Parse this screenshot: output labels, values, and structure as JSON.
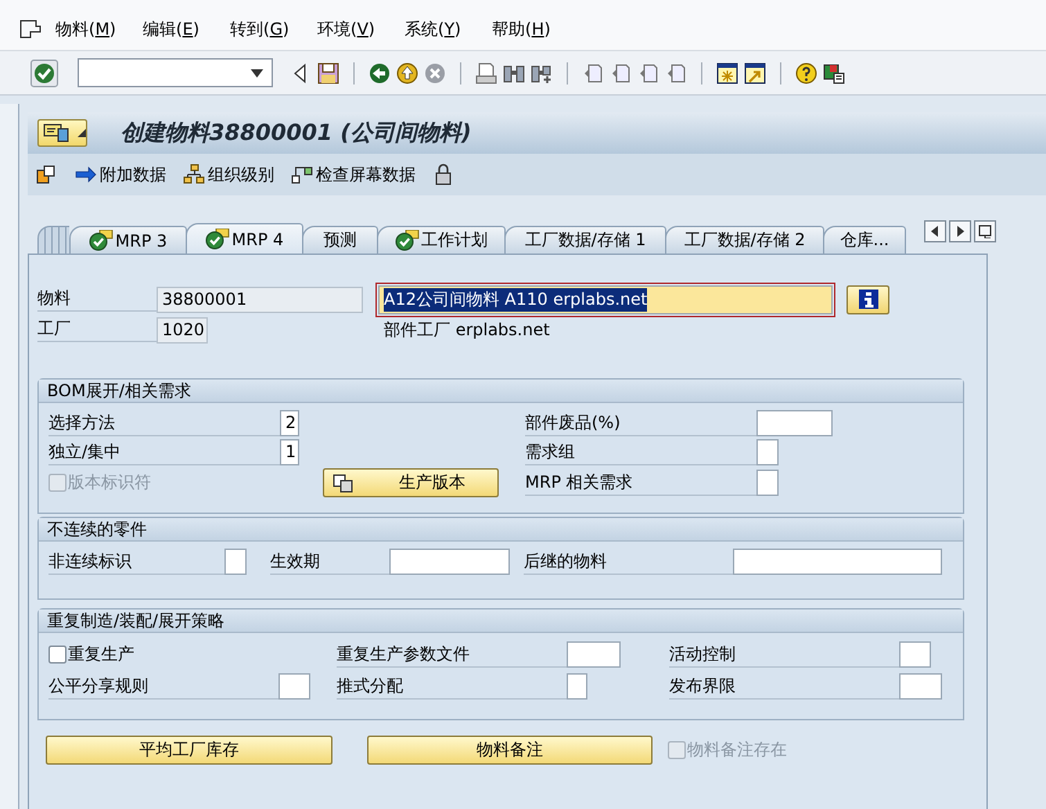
{
  "menu": [
    {
      "label": "物料(M)"
    },
    {
      "label": "编辑(E)"
    },
    {
      "label": "转到(G)"
    },
    {
      "label": "环境(V)"
    },
    {
      "label": "系统(Y)"
    },
    {
      "label": "帮助(H)"
    }
  ],
  "title": "创建物料38800001 (公司间物料)",
  "app_toolbar": [
    {
      "label": "附加数据"
    },
    {
      "label": "组织级别"
    },
    {
      "label": "检查屏幕数据"
    }
  ],
  "tabs": [
    {
      "label": "MRP 3",
      "selected": false,
      "checked": true
    },
    {
      "label": "MRP 4",
      "selected": true,
      "checked": true
    },
    {
      "label": "预测",
      "selected": false,
      "checked": false
    },
    {
      "label": "工作计划",
      "selected": false,
      "checked": true
    },
    {
      "label": "工厂数据/存储 1",
      "selected": false,
      "checked": false
    },
    {
      "label": "工厂数据/存储 2",
      "selected": false,
      "checked": false
    },
    {
      "label": "仓库...",
      "selected": false,
      "checked": false
    }
  ],
  "header": {
    "material_label": "物料",
    "material": "38800001",
    "description": "A12公司间物料 A110 erplabs.net",
    "description_selected": true,
    "plant_label": "工厂",
    "plant": "1020",
    "plant_description": "部件工厂 erplabs.net"
  },
  "bom": {
    "title": "BOM展开/相关需求",
    "selection_method": {
      "label": "选择方法",
      "value": "2"
    },
    "individual_collective": {
      "label": "独立/集中",
      "value": "1"
    },
    "version_indicator": {
      "label": "版本标识符",
      "checked": false,
      "disabled": true
    },
    "production_versions_button": "生产版本",
    "component_scrap": {
      "label": "部件废品(%)"
    },
    "requirements_group": {
      "label": "需求组"
    },
    "mrp_dependent": {
      "label": "MRP 相关需求"
    }
  },
  "discontinued": {
    "title": "不连续的零件",
    "indicator": {
      "label": "非连续标识"
    },
    "effective_out": {
      "label": "生效期"
    },
    "follow_up": {
      "label": "后继的物料"
    }
  },
  "repetitive": {
    "title": "重复制造/装配/展开策略",
    "repetitive_mfg": {
      "label": "重复生产",
      "checked": false,
      "disabled": false
    },
    "rem_profile": {
      "label": "重复生产参数文件"
    },
    "action_control": {
      "label": "活动控制"
    },
    "fair_share": {
      "label": "公平分享规则"
    },
    "push_distribution": {
      "label": "推式分配"
    },
    "release_limit": {
      "label": "发布界限"
    }
  },
  "footer": {
    "plant_stock_button": "平均工厂库存",
    "material_memo_button": "物料备注",
    "memo_exists": {
      "label": "物料备注存在",
      "checked": false,
      "disabled": true
    }
  }
}
